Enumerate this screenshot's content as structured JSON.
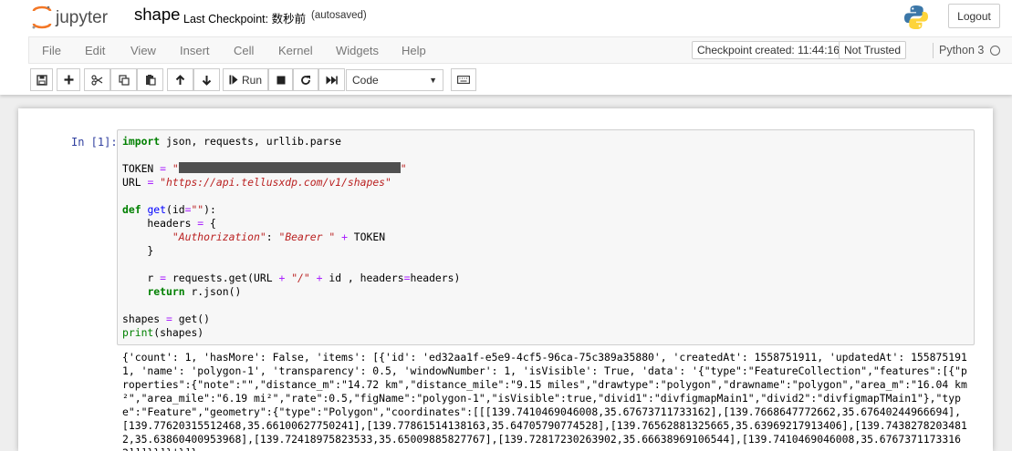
{
  "header": {
    "logo_text": "jupyter",
    "notebook_name": "shape",
    "checkpoint_label": "Last Checkpoint: 数秒前",
    "autosave_status": "(autosaved)",
    "logout_label": "Logout"
  },
  "menubar": {
    "items": [
      "File",
      "Edit",
      "View",
      "Insert",
      "Cell",
      "Kernel",
      "Widgets",
      "Help"
    ],
    "checkpoint_created": "Checkpoint created: 11:44:16",
    "trust_status": "Not Trusted",
    "kernel_name": "Python 3"
  },
  "toolbar": {
    "buttons": [
      "save-icon",
      "plus-icon",
      "cut-icon",
      "copy-icon",
      "paste-icon",
      "arrow-up-icon",
      "arrow-down-icon",
      "run-icon",
      "stop-icon",
      "restart-icon",
      "fast-forward-icon",
      "keyboard-icon"
    ],
    "run_label": "Run",
    "cell_type": "Code"
  },
  "cell": {
    "prompt": "In [1]:",
    "code": {
      "import_kw": "import",
      "import_rest": " json, requests, urllib.parse",
      "token_lhs": "TOKEN ",
      "token_str_open": "\"",
      "token_str_close": "\"",
      "url_lhs": "URL ",
      "url_str": "\"https://api.tellusxdp.com/v1/shapes\"",
      "def_kw": "def",
      "def_name": "get",
      "def_param": "(id",
      "def_default": "\"\"",
      "def_end": "):",
      "headers_lhs": "    headers ",
      "headers_open": " {",
      "auth_key": "\"Authorization\"",
      "auth_colon": ": ",
      "auth_val": "\"Bearer \"",
      "auth_token": " TOKEN",
      "headers_close": "    }",
      "req_lhs": "    r ",
      "req_call": " requests.get(URL ",
      "req_slash": "\"/\"",
      "req_id": " id , headers",
      "req_end": "headers)",
      "ret_kw": "return",
      "ret_rest": " r.json()",
      "shapes_lhs": "shapes ",
      "shapes_rhs": " get()",
      "print_fn": "print",
      "print_rest": "(shapes)"
    },
    "output": "{'count': 1, 'hasMore': False, 'items': [{'id': 'ed32aa1f-e5e9-4cf5-96ca-75c389a35880', 'createdAt': 1558751911, 'updatedAt': 1558751911, 'name': 'polygon-1', 'transparency': 0.5, 'windowNumber': 1, 'isVisible': True, 'data': '{\"type\":\"FeatureCollection\",\"features\":[{\"properties\":{\"note\":\"\",\"distance_m\":\"14.72 km\",\"distance_mile\":\"9.15 miles\",\"drawtype\":\"polygon\",\"drawname\":\"polygon\",\"area_m\":\"16.04 km²\",\"area_mile\":\"6.19 mi²\",\"rate\":0.5,\"figName\":\"polygon-1\",\"isVisible\":true,\"divid1\":\"divfigmapMain1\",\"divid2\":\"divfigmapTMain1\"},\"type\":\"Feature\",\"geometry\":{\"type\":\"Polygon\",\"coordinates\":[[[139.7410469046008,35.67673711733162],[139.7668647772662,35.67640244966694],[139.77620315512468,35.66100627750241],[139.77861514138163,35.64705790774528],[139.76562881325665,35.63969217913406],[139.7438278203481 2,35.63860400953968],[139.72418975823533,35.65009885827767],[139.72817230263902,35.66638969106544],[139.7410469046008,35.67673711733162]]]}}]}'}]}"
  }
}
